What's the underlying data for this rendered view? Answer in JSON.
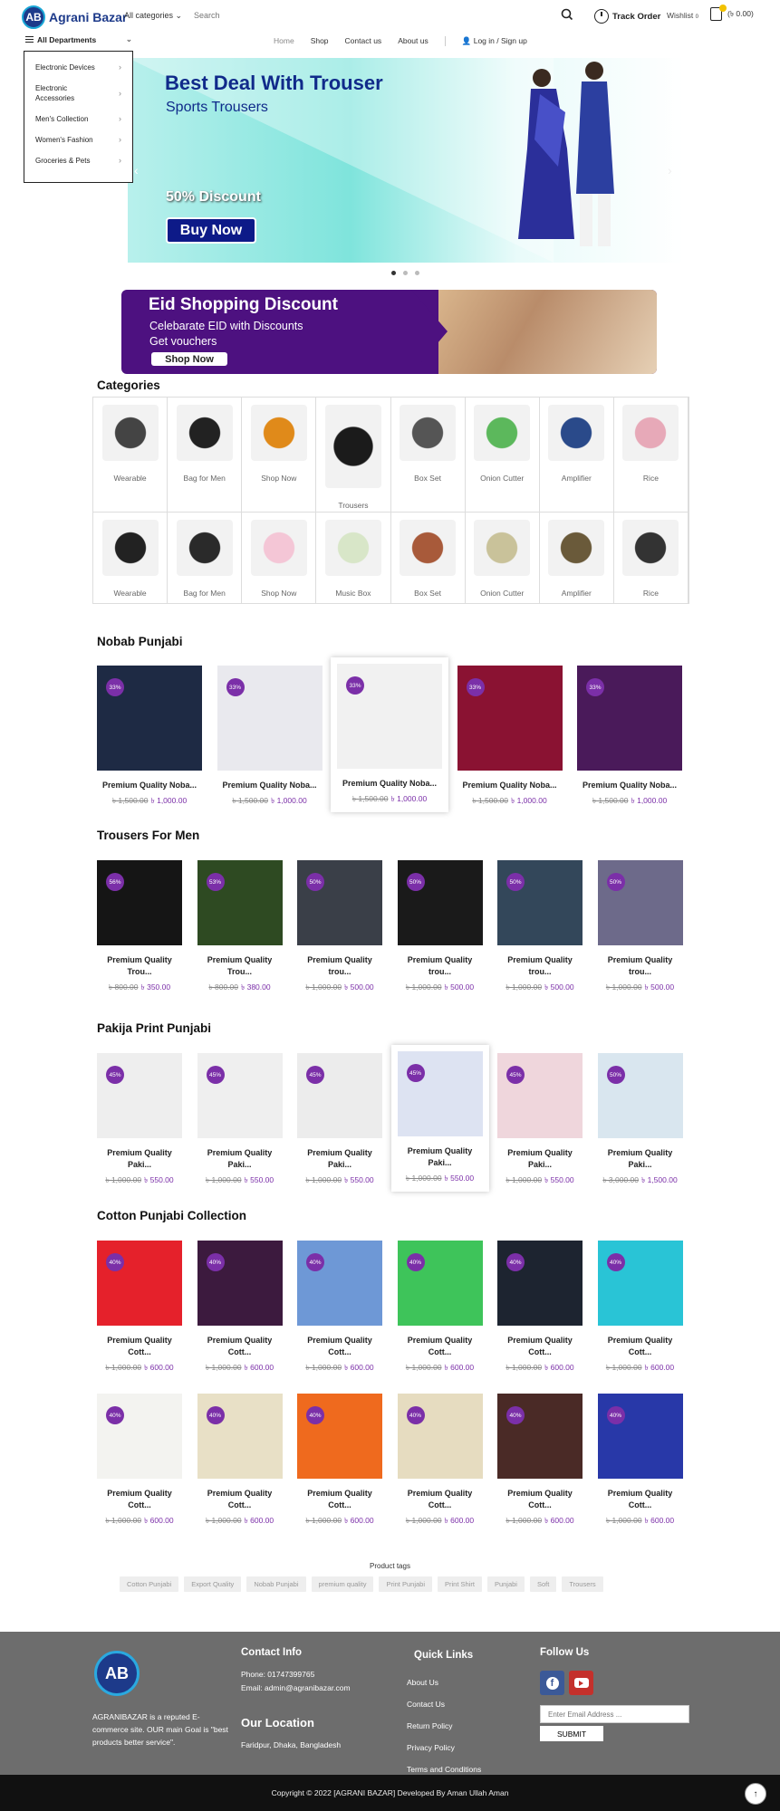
{
  "header": {
    "logo_text": "Agrani Bazar",
    "logo_mark": "AB",
    "category_select": "All categories",
    "search_placeholder": "Search",
    "track_order": "Track Order",
    "wishlist": "Wishlist",
    "wishlist_count": "0",
    "cart_total": "(৳ 0.00)"
  },
  "nav": {
    "all_departments": "All Departments",
    "links": [
      "Home",
      "Shop",
      "Contact us",
      "About us"
    ],
    "login": "Log in / Sign up"
  },
  "departments": [
    "Electronic Devices",
    "Electronic Accessories",
    "Men's Collection",
    "Women's Fashion",
    "Groceries & Pets"
  ],
  "hero": {
    "title": "Best Deal With Trouser",
    "subtitle": "Sports Trousers",
    "discount": "50% Discount",
    "button": "Buy Now",
    "slides": 3,
    "active_slide": 1
  },
  "eid_banner": {
    "title": "Eid Shopping Discount",
    "line1": "Celebarate EID with Discounts",
    "line2": "Get vouchers",
    "button": "Shop Now"
  },
  "categories": {
    "title": "Categories",
    "items": [
      "Wearable",
      "Bag for Men",
      "Shop Now",
      "Trousers",
      "Box Set",
      "Onion Cutter",
      "Amplifier",
      "Rice",
      "Wearable",
      "Bag for Men",
      "Shop Now",
      "Music Box",
      "Box Set",
      "Onion Cutter",
      "Amplifier",
      "Rice"
    ]
  },
  "sections": [
    {
      "title": "Nobab Punjabi",
      "products": [
        {
          "name": "Premium Quality Noba...",
          "old": "৳ 1,500.00",
          "new": "৳ 1,000.00",
          "discount": "33%",
          "color": "#1e2a44"
        },
        {
          "name": "Premium Quality Noba...",
          "old": "৳ 1,500.00",
          "new": "৳ 1,000.00",
          "discount": "33%",
          "color": "#e9e9ee"
        },
        {
          "name": "Premium Quality Noba...",
          "old": "৳ 1,500.00",
          "new": "৳ 1,000.00",
          "discount": "33%",
          "color": "#f1f1f1"
        },
        {
          "name": "Premium Quality Noba...",
          "old": "৳ 1,500.00",
          "new": "৳ 1,000.00",
          "discount": "33%",
          "color": "#8a1232"
        },
        {
          "name": "Premium Quality Noba...",
          "old": "৳ 1,500.00",
          "new": "৳ 1,000.00",
          "discount": "33%",
          "color": "#4a1a5a"
        }
      ]
    },
    {
      "title": "Trousers For Men",
      "products": [
        {
          "name": "Premium Quality Trou...",
          "old": "৳ 800.00",
          "new": "৳ 350.00",
          "discount": "56%",
          "color": "#151515"
        },
        {
          "name": "Premium Quality Trou...",
          "old": "৳ 800.00",
          "new": "৳ 380.00",
          "discount": "53%",
          "color": "#2e4a22"
        },
        {
          "name": "Premium Quality trou...",
          "old": "৳ 1,000.00",
          "new": "৳ 500.00",
          "discount": "50%",
          "color": "#3a3f48"
        },
        {
          "name": "Premium Quality trou...",
          "old": "৳ 1,000.00",
          "new": "৳ 500.00",
          "discount": "50%",
          "color": "#1a1a1a"
        },
        {
          "name": "Premium Quality trou...",
          "old": "৳ 1,000.00",
          "new": "৳ 500.00",
          "discount": "50%",
          "color": "#33475a"
        },
        {
          "name": "Premium Quality trou...",
          "old": "৳ 1,000.00",
          "new": "৳ 500.00",
          "discount": "50%",
          "color": "#6d6a8a"
        }
      ]
    },
    {
      "title": "Pakija Print Punjabi",
      "products": [
        {
          "name": "Premium Quality Paki...",
          "old": "৳ 1,000.00",
          "new": "৳ 550.00",
          "discount": "45%",
          "color": "#eeeeee"
        },
        {
          "name": "Premium Quality Paki...",
          "old": "৳ 1,000.00",
          "new": "৳ 550.00",
          "discount": "45%",
          "color": "#efefef"
        },
        {
          "name": "Premium Quality Paki...",
          "old": "৳ 1,000.00",
          "new": "৳ 550.00",
          "discount": "45%",
          "color": "#ececec"
        },
        {
          "name": "Premium Quality Paki...",
          "old": "৳ 1,000.00",
          "new": "৳ 550.00",
          "discount": "45%",
          "color": "#dde3f2"
        },
        {
          "name": "Premium Quality Paki...",
          "old": "৳ 1,000.00",
          "new": "৳ 550.00",
          "discount": "45%",
          "color": "#efd6dc"
        },
        {
          "name": "Premium Quality Paki...",
          "old": "৳ 3,000.00",
          "new": "৳ 1,500.00",
          "discount": "50%",
          "color": "#d9e6ef"
        }
      ]
    },
    {
      "title": "Cotton Punjabi Collection",
      "products": [
        {
          "name": "Premium Quality Cott...",
          "old": "৳ 1,000.00",
          "new": "৳ 600.00",
          "discount": "40%",
          "color": "#e5212b"
        },
        {
          "name": "Premium Quality Cott...",
          "old": "৳ 1,000.00",
          "new": "৳ 600.00",
          "discount": "40%",
          "color": "#3c1a3e"
        },
        {
          "name": "Premium Quality Cott...",
          "old": "৳ 1,000.00",
          "new": "৳ 600.00",
          "discount": "40%",
          "color": "#6e98d6"
        },
        {
          "name": "Premium Quality Cott...",
          "old": "৳ 1,000.00",
          "new": "৳ 600.00",
          "discount": "40%",
          "color": "#3ec45a"
        },
        {
          "name": "Premium Quality Cott...",
          "old": "৳ 1,000.00",
          "new": "৳ 600.00",
          "discount": "40%",
          "color": "#1d2430"
        },
        {
          "name": "Premium Quality Cott...",
          "old": "৳ 1,000.00",
          "new": "৳ 600.00",
          "discount": "40%",
          "color": "#29c4d6"
        },
        {
          "name": "Premium Quality Cott...",
          "old": "৳ 1,000.00",
          "new": "৳ 600.00",
          "discount": "40%",
          "color": "#f3f3f0"
        },
        {
          "name": "Premium Quality Cott...",
          "old": "৳ 1,000.00",
          "new": "৳ 600.00",
          "discount": "40%",
          "color": "#e8e0c6"
        },
        {
          "name": "Premium Quality Cott...",
          "old": "৳ 1,000.00",
          "new": "৳ 600.00",
          "discount": "40%",
          "color": "#ef6a1e"
        },
        {
          "name": "Premium Quality Cott...",
          "old": "৳ 1,000.00",
          "new": "৳ 600.00",
          "discount": "40%",
          "color": "#e6dcc0"
        },
        {
          "name": "Premium Quality Cott...",
          "old": "৳ 1,000.00",
          "new": "৳ 600.00",
          "discount": "40%",
          "color": "#4a2a26"
        },
        {
          "name": "Premium Quality Cott...",
          "old": "৳ 1,000.00",
          "new": "৳ 600.00",
          "discount": "40%",
          "color": "#2838a8"
        }
      ]
    }
  ],
  "product_tags": {
    "title": "Product tags",
    "tags": [
      "Cotton Punjabi",
      "Export Quality",
      "Nobab Punjabi",
      "premium quality",
      "Print Punjabi",
      "Print Shirt",
      "Punjabi",
      "Soft",
      "Trousers"
    ]
  },
  "footer": {
    "logo_mark": "AB",
    "about": "AGRANIBAZAR is a reputed E-commerce site. OUR main Goal is \"best products better service\".",
    "contact_title": "Contact Info",
    "phone": "Phone: 01747399765",
    "email": "Email: admin@agranibazar.com",
    "location_title": "Our Location",
    "address": "Faridpur, Dhaka, Bangladesh",
    "quick_links_title": "Quick Links",
    "quick_links": [
      "About Us",
      "Contact Us",
      "Return Policy",
      "Privacy Policy",
      "Terms and Conditions"
    ],
    "follow_title": "Follow Us",
    "email_placeholder": "Enter Email Address ...",
    "submit": "SUBMIT",
    "copyright": "Copyright © 2022 [AGRANI BAZAR] Developed By Aman Ullah Aman"
  },
  "colors": {
    "brand": "#1d3a8a",
    "accent": "#7b2fa8",
    "footer": "#6d6d6d"
  }
}
